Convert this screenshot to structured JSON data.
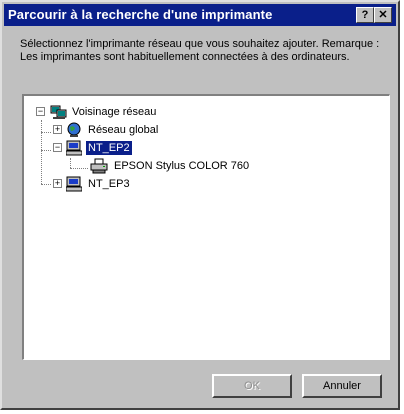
{
  "dialog": {
    "title": "Parcourir à la recherche d'une imprimante",
    "help_glyph": "?",
    "close_glyph": "✕",
    "instructions": "Sélectionnez l'imprimante réseau que vous souhaitez ajouter. Remarque : Les imprimantes sont habituellement connectées à des ordinateurs."
  },
  "tree": {
    "root": {
      "label": "Voisinage réseau",
      "expander": "−",
      "icon": "network-neighborhood-icon"
    },
    "items": [
      {
        "label": "Réseau global",
        "expander": "+",
        "icon": "globe-network-icon"
      },
      {
        "label": "NT_EP2",
        "expander": "−",
        "icon": "computer-icon",
        "selected": true
      },
      {
        "label": "EPSON Stylus COLOR 760",
        "icon": "printer-icon"
      },
      {
        "label": "NT_EP3",
        "expander": "+",
        "icon": "computer-icon"
      }
    ]
  },
  "buttons": {
    "ok_label": "OK",
    "cancel_label": "Annuler"
  },
  "colors": {
    "titlebar": "#0a1f8a",
    "selection": "#0a1f8a",
    "face": "#c0c0c0"
  }
}
